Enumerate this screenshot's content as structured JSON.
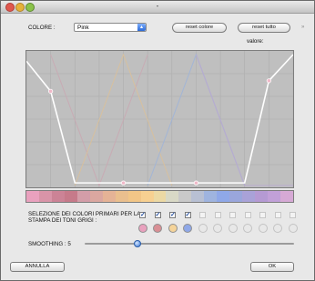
{
  "window": {
    "title": "-"
  },
  "header": {
    "colore_label": "COLORE :",
    "colore_select_value": "Pink",
    "reset_colore_label": "reset colore",
    "reset_tutto_label": "reset tutto",
    "valore_label": "valore:"
  },
  "chart_data": {
    "type": "line",
    "title": "",
    "xlabel": "",
    "ylabel": "",
    "xlim": [
      0,
      11
    ],
    "ylim": [
      0,
      1
    ],
    "grid": true,
    "series": [
      {
        "x": [
          0,
          1,
          2,
          3,
          4,
          5,
          6,
          7,
          8,
          9,
          10,
          11
        ],
        "y": [
          0.95,
          0.72,
          0.02,
          0.02,
          0.02,
          0.02,
          0.02,
          0.02,
          0.02,
          0.02,
          0.8,
          1.0
        ],
        "color": "#ffffff"
      }
    ],
    "markers": [
      {
        "x": 1,
        "y": 0.72,
        "color": "#f0b8c8"
      },
      {
        "x": 4,
        "y": 0.02,
        "color": "#f0b8c8"
      },
      {
        "x": 7,
        "y": 0.02,
        "color": "#f0b8c8"
      },
      {
        "x": 10,
        "y": 0.8,
        "color": "#f0b8c8"
      }
    ],
    "background_curves": [
      {
        "color": "#c9a8b2",
        "x": [
          1,
          3,
          5
        ],
        "y": [
          1,
          0,
          1
        ]
      },
      {
        "color": "#d9c09a",
        "x": [
          2,
          4,
          6
        ],
        "y": [
          0,
          1,
          0
        ]
      },
      {
        "color": "#9fb4d8",
        "x": [
          5,
          7,
          9
        ],
        "y": [
          0,
          1,
          0
        ]
      },
      {
        "color": "#b9a8d0",
        "x": [
          7,
          9,
          11
        ],
        "y": [
          1,
          0,
          0
        ]
      }
    ]
  },
  "palette": [
    "#e9a1be",
    "#d994a8",
    "#cc8396",
    "#c67a8a",
    "#d39da8",
    "#dba7a0",
    "#e5b396",
    "#eabf8e",
    "#f2c687",
    "#f7d091",
    "#ecd9a4",
    "#d9d9c6",
    "#c9c9c9",
    "#b8c0d3",
    "#9fb4df",
    "#8fa8e8",
    "#9aa6dc",
    "#a9a2d8",
    "#b59ad3",
    "#c1a0d8",
    "#d6a9d5"
  ],
  "selection": {
    "label_line1": "SELEZIONE DEI COLORI PRIMARI PER LA",
    "label_line2": "STAMPA DEI TONI GRIGI :",
    "checks": [
      true,
      true,
      true,
      true,
      false,
      false,
      false,
      false,
      false,
      false,
      false
    ],
    "dots": [
      "#e9a1be",
      "#d98f95",
      "#f5d49a",
      "#8fa8e8",
      "",
      "",
      "",
      "",
      "",
      "",
      ""
    ]
  },
  "smoothing": {
    "label": "SMOOTHING : 5",
    "value": 5,
    "max": 20
  },
  "footer": {
    "annulla_label": "ANNULLA",
    "ok_label": "OK"
  }
}
